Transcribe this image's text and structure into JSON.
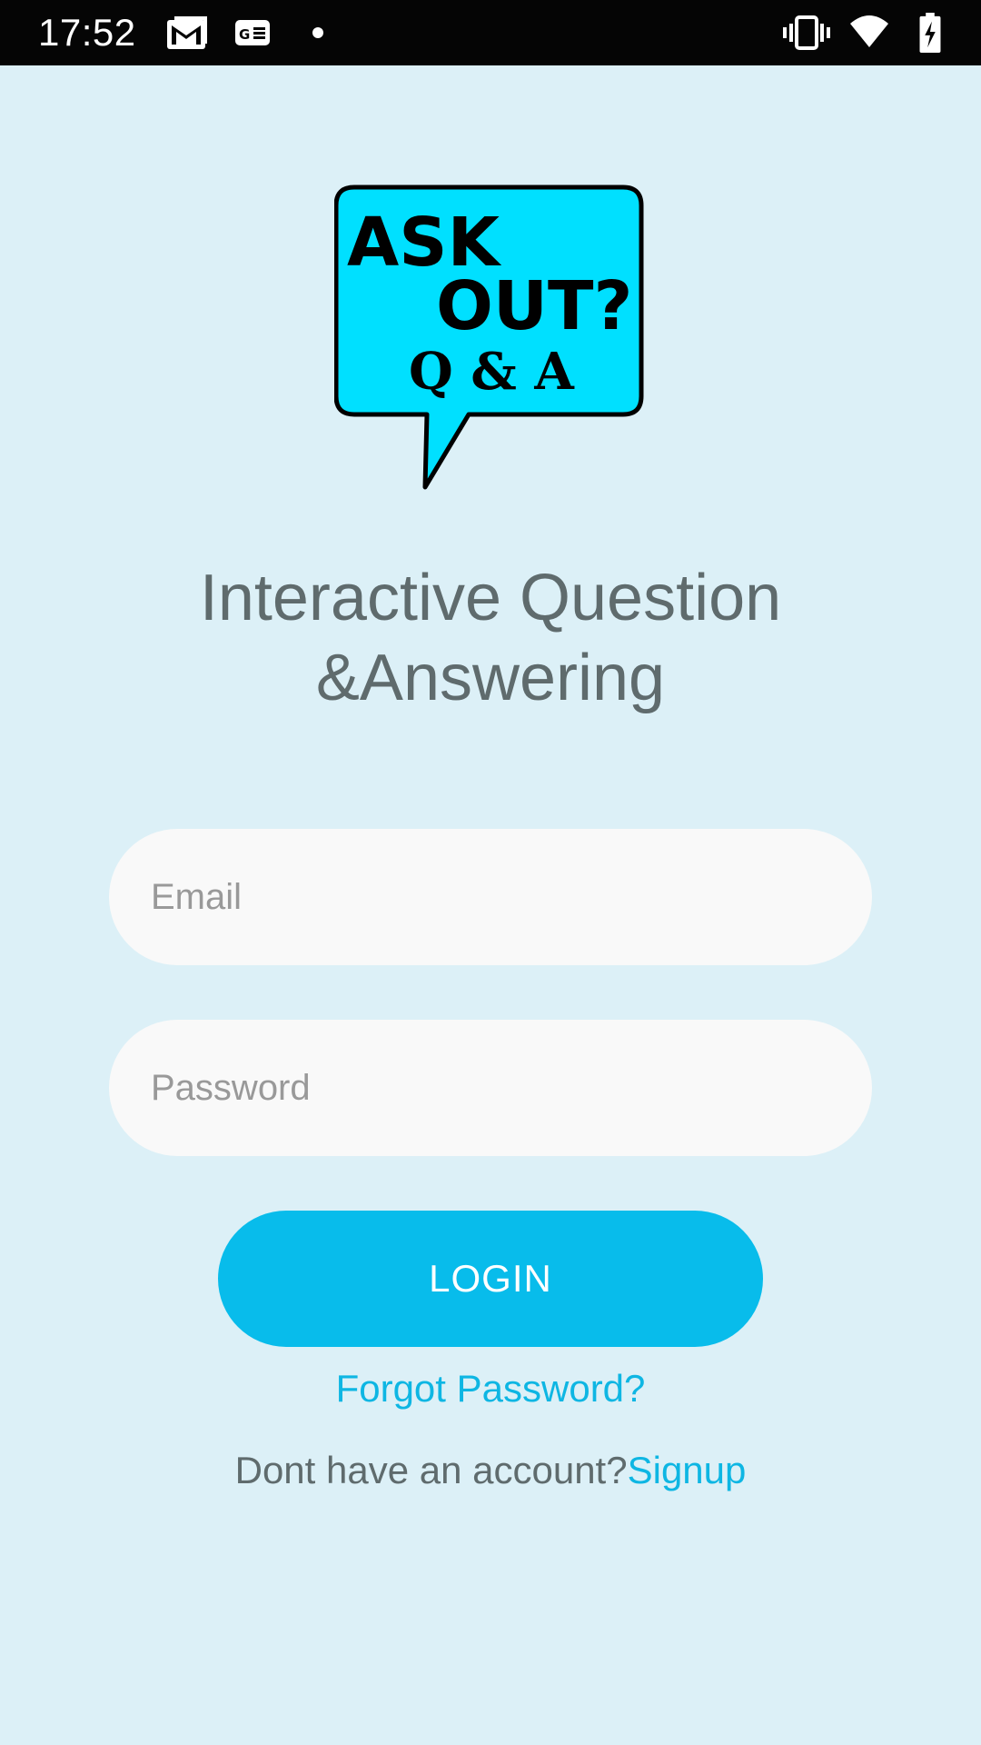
{
  "status_bar": {
    "time": "17:52",
    "left_icons": [
      "gmail-icon",
      "news-card-icon",
      "notification-dot-icon"
    ],
    "right_icons": [
      "vibrate-icon",
      "wifi-icon",
      "battery-charging-icon"
    ]
  },
  "logo": {
    "line1": "ASK",
    "line2": "OUT?",
    "line3": "Q & A",
    "fill_color": "#00e0ff"
  },
  "headline": {
    "line1": "Interactive Question",
    "line2": "&Answering"
  },
  "form": {
    "email_placeholder": "Email",
    "password_placeholder": "Password",
    "login_label": "LOGIN",
    "forgot_label": "Forgot Password?",
    "signup_prompt": "Dont have an account?",
    "signup_label": "Signup"
  },
  "colors": {
    "background": "#dcf0f7",
    "accent": "#08bceb",
    "text_gray": "#5f6b6d",
    "field_bg": "#f9f9f9"
  }
}
